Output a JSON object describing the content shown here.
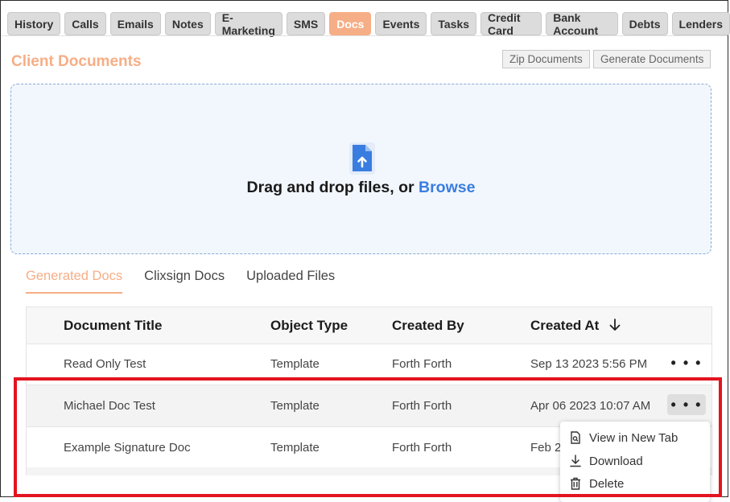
{
  "tabs": [
    "History",
    "Calls",
    "Emails",
    "Notes",
    "E-Marketing",
    "SMS",
    "Docs",
    "Events",
    "Tasks",
    "Credit Card",
    "Bank Account",
    "Debts",
    "Lenders"
  ],
  "active_tab": "Docs",
  "page_title": "Client Documents",
  "toolbar": {
    "zip_label": "Zip Documents",
    "generate_label": "Generate Documents"
  },
  "dropzone": {
    "text": "Drag and drop files, or",
    "browse_label": "Browse"
  },
  "subtabs": [
    "Generated Docs",
    "Clixsign Docs",
    "Uploaded Files"
  ],
  "table": {
    "headers": [
      "Document Title",
      "Object Type",
      "Created By",
      "Created At"
    ],
    "rows": [
      {
        "title": "Read Only Test",
        "type": "Template",
        "created_by": "Forth Forth",
        "created_at": "Sep 13 2023 5:56 PM"
      },
      {
        "title": "Michael Doc Test",
        "type": "Template",
        "created_by": "Forth Forth",
        "created_at": "Apr 06 2023 10:07 AM"
      },
      {
        "title": "Example Signature Doc",
        "type": "Template",
        "created_by": "Forth Forth",
        "created_at": "Feb 2"
      }
    ],
    "more_label": "• • •"
  },
  "row_menu": {
    "view": "View in New Tab",
    "download": "Download",
    "delete": "Delete"
  },
  "colors": {
    "accent": "#f6ae86",
    "link": "#3a7de0",
    "highlight": "#e3141f"
  }
}
